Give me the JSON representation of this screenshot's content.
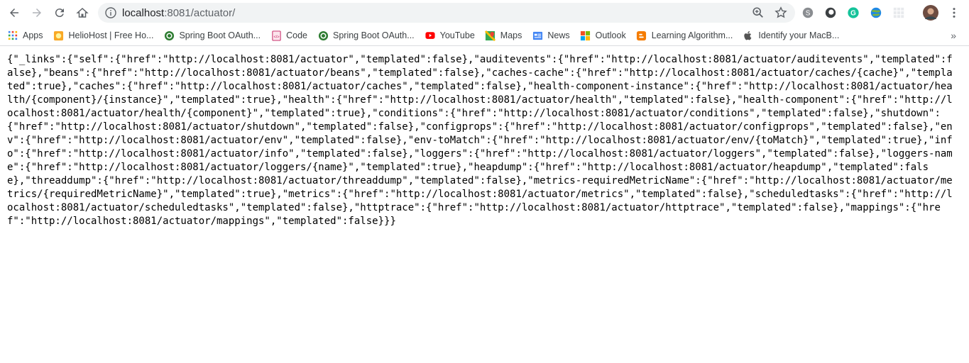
{
  "browser": {
    "url_host": "localhost",
    "url_rest": ":8081/actuator/"
  },
  "bookmarks": [
    {
      "label": "Apps",
      "icon": "apps-grid-icon"
    },
    {
      "label": "HelioHost | Free Ho...",
      "icon": "heliohost-icon"
    },
    {
      "label": "Spring Boot OAuth...",
      "icon": "spring-icon"
    },
    {
      "label": "Code",
      "icon": "code-icon"
    },
    {
      "label": "Spring Boot OAuth...",
      "icon": "spring-icon"
    },
    {
      "label": "YouTube",
      "icon": "youtube-icon"
    },
    {
      "label": "Maps",
      "icon": "maps-icon"
    },
    {
      "label": "News",
      "icon": "news-icon"
    },
    {
      "label": "Outlook",
      "icon": "outlook-icon"
    },
    {
      "label": "Learning Algorithm...",
      "icon": "blogger-icon"
    },
    {
      "label": "Identify your MacB...",
      "icon": "apple-icon"
    }
  ],
  "body_text": "{\"_links\":{\"self\":{\"href\":\"http://localhost:8081/actuator\",\"templated\":false},\"auditevents\":{\"href\":\"http://localhost:8081/actuator/auditevents\",\"templated\":false},\"beans\":{\"href\":\"http://localhost:8081/actuator/beans\",\"templated\":false},\"caches-cache\":{\"href\":\"http://localhost:8081/actuator/caches/{cache}\",\"templated\":true},\"caches\":{\"href\":\"http://localhost:8081/actuator/caches\",\"templated\":false},\"health-component-instance\":{\"href\":\"http://localhost:8081/actuator/health/{component}/{instance}\",\"templated\":true},\"health\":{\"href\":\"http://localhost:8081/actuator/health\",\"templated\":false},\"health-component\":{\"href\":\"http://localhost:8081/actuator/health/{component}\",\"templated\":true},\"conditions\":{\"href\":\"http://localhost:8081/actuator/conditions\",\"templated\":false},\"shutdown\":{\"href\":\"http://localhost:8081/actuator/shutdown\",\"templated\":false},\"configprops\":{\"href\":\"http://localhost:8081/actuator/configprops\",\"templated\":false},\"env\":{\"href\":\"http://localhost:8081/actuator/env\",\"templated\":false},\"env-toMatch\":{\"href\":\"http://localhost:8081/actuator/env/{toMatch}\",\"templated\":true},\"info\":{\"href\":\"http://localhost:8081/actuator/info\",\"templated\":false},\"loggers\":{\"href\":\"http://localhost:8081/actuator/loggers\",\"templated\":false},\"loggers-name\":{\"href\":\"http://localhost:8081/actuator/loggers/{name}\",\"templated\":true},\"heapdump\":{\"href\":\"http://localhost:8081/actuator/heapdump\",\"templated\":false},\"threaddump\":{\"href\":\"http://localhost:8081/actuator/threaddump\",\"templated\":false},\"metrics-requiredMetricName\":{\"href\":\"http://localhost:8081/actuator/metrics/{requiredMetricName}\",\"templated\":true},\"metrics\":{\"href\":\"http://localhost:8081/actuator/metrics\",\"templated\":false},\"scheduledtasks\":{\"href\":\"http://localhost:8081/actuator/scheduledtasks\",\"templated\":false},\"httptrace\":{\"href\":\"http://localhost:8081/actuator/httptrace\",\"templated\":false},\"mappings\":{\"href\":\"http://localhost:8081/actuator/mappings\",\"templated\":false}}}"
}
